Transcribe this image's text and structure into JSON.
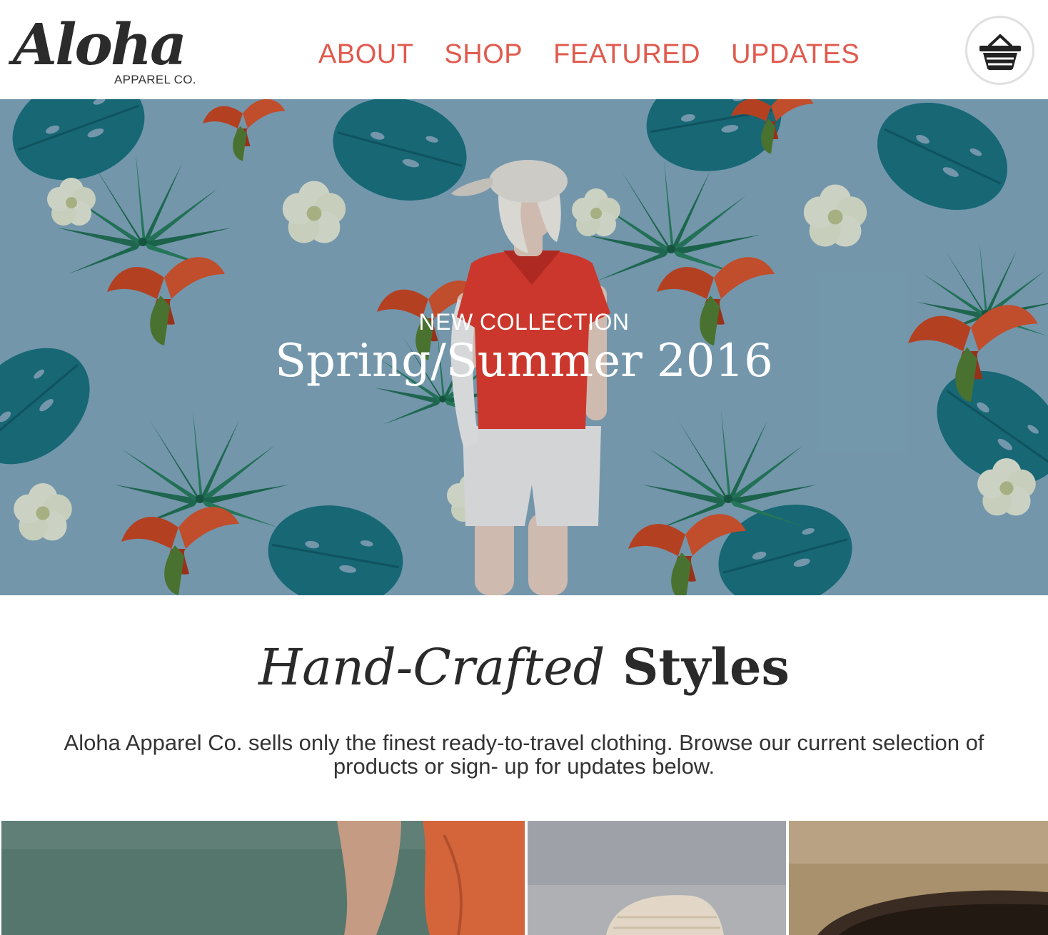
{
  "header": {
    "logo": {
      "script": "Aloha",
      "subtitle": "APPAREL CO."
    },
    "nav": [
      {
        "label": "ABOUT"
      },
      {
        "label": "SHOP"
      },
      {
        "label": "FEATURED"
      },
      {
        "label": "UPDATES"
      }
    ],
    "cart_icon": "shopping-basket-icon"
  },
  "hero": {
    "kicker": "NEW COLLECTION",
    "title": "Spring/Summer 2016"
  },
  "intro": {
    "heading_italic": "Hand-Crafted",
    "heading_bold": "Styles",
    "text": "Aloha Apparel Co. sells only the finest ready-to-travel clothing. Browse our current selection of products or sign- up for updates below."
  },
  "colors": {
    "accent": "#e05a4e",
    "text_dark": "#2a2a2a",
    "hero_bg": "#7fa6bb"
  }
}
